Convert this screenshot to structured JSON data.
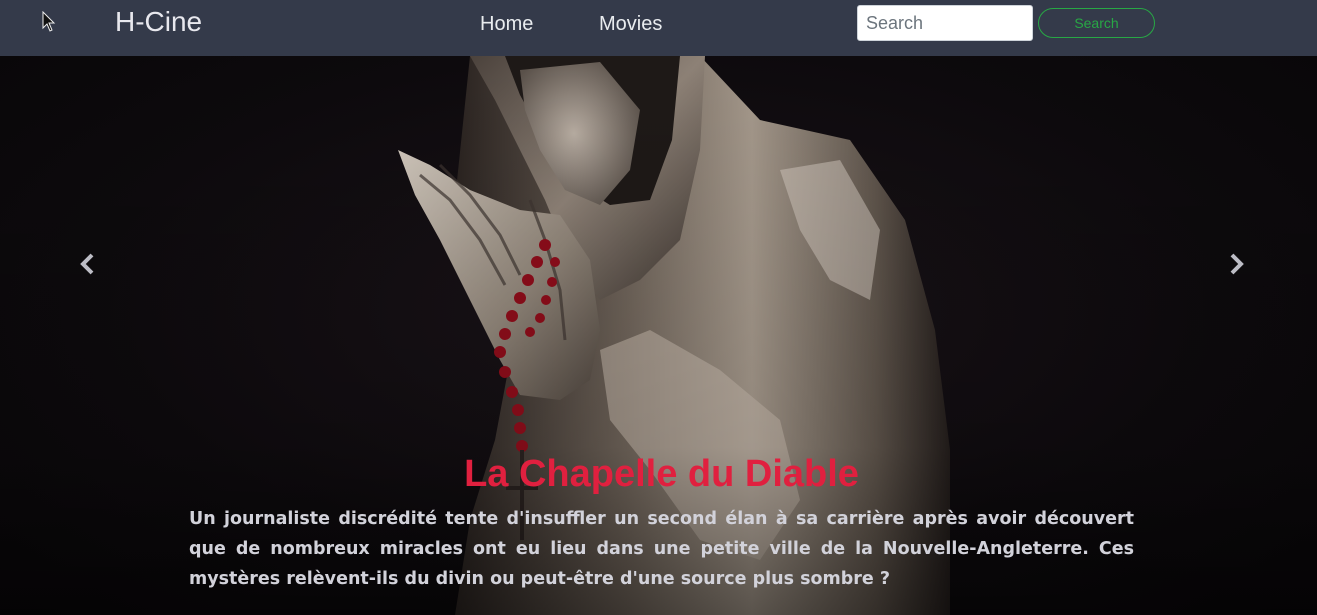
{
  "navbar": {
    "brand": "H-Cine",
    "links": [
      {
        "label": "Home"
      },
      {
        "label": "Movies"
      }
    ],
    "search": {
      "placeholder": "Search",
      "value": "",
      "button_label": "Search"
    }
  },
  "carousel": {
    "slide": {
      "title": "La Chapelle du Diable",
      "description": "Un journaliste discrédité tente d'insuffler un second élan à sa carrière après avoir découvert que de nombreux miracles ont eu lieu dans une petite ville de la Nouvelle-Angleterre. Ces mystères relèvent-ils du divin ou peut-être d'une source plus sombre ?"
    },
    "controls": {
      "prev_icon": "chevron-left-icon",
      "next_icon": "chevron-right-icon"
    }
  },
  "colors": {
    "navbar_bg": "#343a4a",
    "title_red": "#e0203f",
    "search_green": "#28a745",
    "rosary_red": "#8c0d1a"
  }
}
